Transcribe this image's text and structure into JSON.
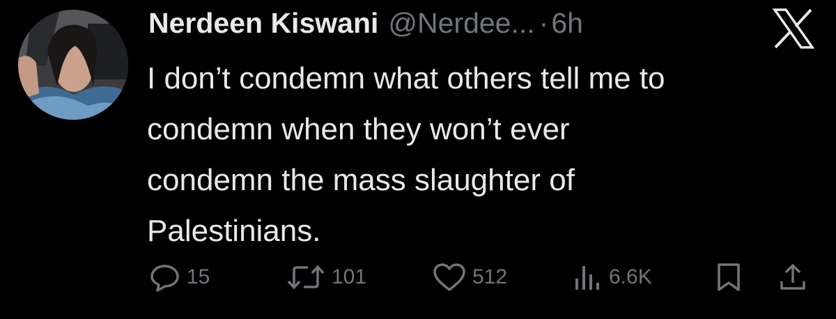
{
  "tweet": {
    "author": {
      "display_name": "Nerdeen Kiswani",
      "handle": "@Nerdee...",
      "dot": "·",
      "time": "6h"
    },
    "text": "I don’t condemn what others tell me to\ncondemn when they won’t ever\ncondemn the mass slaughter of\nPalestinians.",
    "actions": {
      "replies": "15",
      "reposts": "101",
      "likes": "512",
      "views": "6.6K"
    }
  },
  "colors": {
    "background": "#000000",
    "text_primary": "#e7e9ea",
    "text_secondary": "#71767b"
  },
  "icons": [
    "x-logo-icon",
    "reply-icon",
    "repost-icon",
    "like-icon",
    "views-icon",
    "bookmark-icon",
    "share-icon"
  ]
}
